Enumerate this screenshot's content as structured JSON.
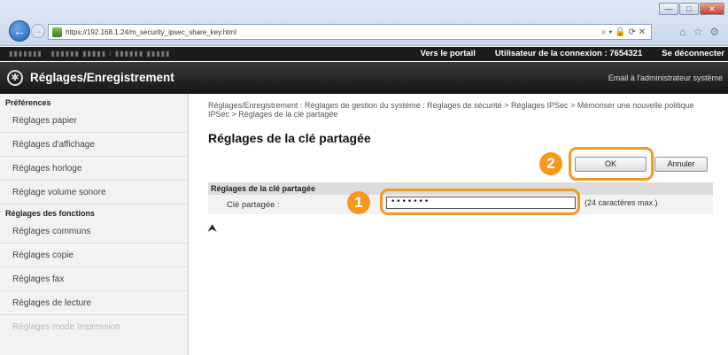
{
  "browser": {
    "url": "https://192.168.1.24/m_security_ipsec_share_key.html",
    "window_buttons": {
      "minimize": "—",
      "maximize": "□",
      "close": "✕"
    },
    "nav": {
      "back": "←",
      "forward": "→"
    },
    "addr_tools": "⌕ ▾ 🔒 ⟳ ✕",
    "icons": [
      "home-icon",
      "star-icon",
      "gear-icon"
    ]
  },
  "topbar": {
    "portal_link": "Vers le portail",
    "user_label": "Utilisateur de la connexion :  7654321",
    "logout_link": "Se déconnecter"
  },
  "header": {
    "title": "Réglages/Enregistrement",
    "admin_mail": "Email à l'administrateur système"
  },
  "sidebar": {
    "section1": "Préférences",
    "items1": [
      "Réglages papier",
      "Réglages d'affichage",
      "Réglages horloge",
      "Réglage volume sonore"
    ],
    "section2": "Réglages des fonctions",
    "items2": [
      "Réglages communs",
      "Réglages copie",
      "Réglages fax",
      "Réglages de lecture",
      "Réglages mode Impression"
    ]
  },
  "main": {
    "breadcrumb": "Réglages/Enregistrement : Réglages de gestion du système : Réglages de sécurité > Réglages IPSec > Mémoriser une nouvelle politique IPSec > Réglages de la clé partagée",
    "page_title": "Réglages de la clé partagée",
    "ok_label": "OK",
    "cancel_label": "Annuler",
    "badge1": "1",
    "badge2": "2",
    "section_title": "Réglages de la clé partagée",
    "field_label": "Clé partagée :",
    "field_value": "•••••••",
    "field_hint": "(24 caractères max.)",
    "top_link": "⮝"
  },
  "colors": {
    "accent": "#f39a1e",
    "header_bg": "#1c1c1c"
  }
}
